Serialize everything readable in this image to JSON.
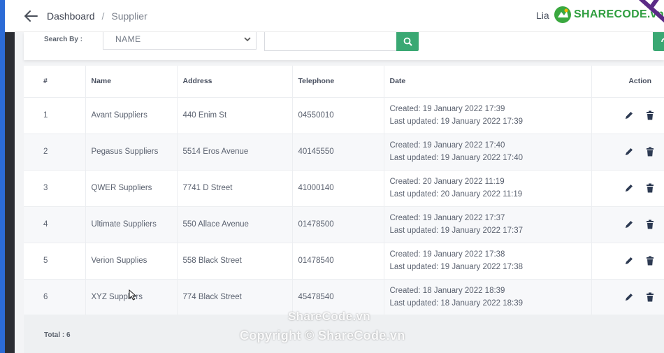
{
  "header": {
    "breadcrumb": [
      {
        "label": "Dashboard"
      },
      {
        "label": "Supplier"
      }
    ],
    "separator": "/",
    "user_partial": "Lia",
    "brand_text": "SHARECODE.vn"
  },
  "search": {
    "label": "Search By :",
    "selected_field": "NAME",
    "query": "",
    "accent_color": "#3aa873"
  },
  "table": {
    "columns": [
      "#",
      "Name",
      "Address",
      "Telephone",
      "Date",
      "Action"
    ],
    "rows": [
      {
        "num": "1",
        "name": "Avant Suppliers",
        "address": "440 Enim St",
        "telephone": "04550010",
        "created": "Created: 19 January 2022 17:39",
        "updated": "Last updated: 19 January 2022 17:39"
      },
      {
        "num": "2",
        "name": "Pegasus Suppliers",
        "address": "5514 Eros Avenue",
        "telephone": "40145550",
        "created": "Created: 19 January 2022 17:40",
        "updated": "Last updated: 19 January 2022 17:40"
      },
      {
        "num": "3",
        "name": "QWER Suppliers",
        "address": "7741 D Street",
        "telephone": "41000140",
        "created": "Created: 20 January 2022 11:19",
        "updated": "Last updated: 20 January 2022 11:19"
      },
      {
        "num": "4",
        "name": "Ultimate Suppliers",
        "address": "550 Allace Avenue",
        "telephone": "01478500",
        "created": "Created: 19 January 2022 17:37",
        "updated": "Last updated: 19 January 2022 17:37"
      },
      {
        "num": "5",
        "name": "Verion Supplies",
        "address": "558 Black Street",
        "telephone": "01478540",
        "created": "Created: 19 January 2022 17:38",
        "updated": "Last updated: 19 January 2022 17:38"
      },
      {
        "num": "6",
        "name": "XYZ Suppliers",
        "address": "774 Black Street",
        "telephone": "45478540",
        "created": "Created: 18 January 2022 18:39",
        "updated": "Last updated: 18 January 2022 18:39"
      }
    ],
    "row_actions": [
      "edit-icon",
      "delete-icon"
    ]
  },
  "footer": {
    "total_label": "Total : 6"
  },
  "watermark": {
    "line1": "ShareCode.vn",
    "line2": "Copyright © ShareCode.vn"
  },
  "colors": {
    "accent_green": "#3aa873",
    "sidebar_blue": "#2c6bd6",
    "action_icon": "#2d3a52"
  }
}
